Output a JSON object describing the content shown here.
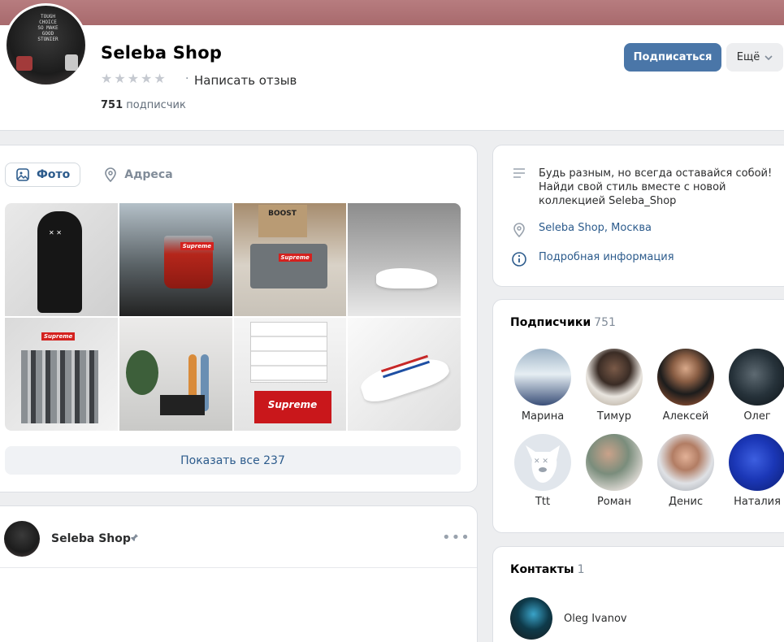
{
  "profile": {
    "name": "Seleba Shop",
    "review_link": "Написать отзыв",
    "review_separator": "·",
    "followers_count": "751",
    "followers_label": "подписчик",
    "rating_stars": 5,
    "avatar_shirt_text": "TOUGH CHOICE SO MAKE GOOD STONIER"
  },
  "actions": {
    "subscribe_label": "Подписаться",
    "more_label": "Ещё"
  },
  "photos": {
    "tabs": [
      {
        "label": "Фото",
        "icon": "image-icon",
        "active": true
      },
      {
        "label": "Адреса",
        "icon": "location-pin-icon",
        "active": false
      }
    ],
    "show_all_label": "Показать все 237",
    "brand_label": "Supreme",
    "boost_label": "BOOST"
  },
  "post": {
    "author": "Seleba Shop",
    "pin_icon": "pin-icon",
    "menu_icon": "more-dots-icon"
  },
  "info": {
    "description": "Будь разным, но всегда оставайся собой! Найди свой стиль вместе с новой коллекцией Seleba_Shop",
    "address": "Seleba Shop, Москва",
    "details_link": "Подробная информация"
  },
  "subscribers": {
    "title": "Подписчики",
    "count": "751",
    "people": [
      {
        "name": "Марина"
      },
      {
        "name": "Тимур"
      },
      {
        "name": "Алексей"
      },
      {
        "name": "Олег"
      },
      {
        "name": "Ttt"
      },
      {
        "name": "Роман"
      },
      {
        "name": "Денис"
      },
      {
        "name": "Наталия"
      }
    ]
  },
  "contacts": {
    "title": "Контакты",
    "count": "1",
    "items": [
      {
        "name": "Oleg Ivanov"
      }
    ]
  },
  "colors": {
    "accent": "#4a76a8",
    "link": "#2c5b8c",
    "cover": "#b07275",
    "background": "#edeef0"
  }
}
